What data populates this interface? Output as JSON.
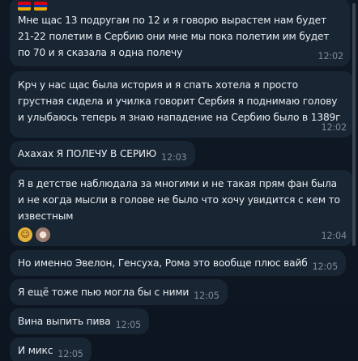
{
  "messages": [
    {
      "flags": [
        "armenia-flag",
        "armenia-flag"
      ],
      "text": "Мне щас 13 подругам по 12 и я говорю вырастем нам будет 21-22 полетим в Сербию они мне мы пока полетим им будет по 70 и я сказала я одна полечу",
      "time": "12:02"
    },
    {
      "text": "Крч у нас щас была история и я спать хотела я просто грустная сидела и училка говорит Сербия  я поднимаю голову и улыбаюсь теперь я знаю нападение на Сербию было в 1389г",
      "time": "12:02"
    },
    {
      "text": "Ахахах Я ПОЛЕЧУ В СЕРИЮ",
      "time": "12:03"
    },
    {
      "text": "Я в детстве наблюдала за многими и не такая прям фан была и не когда мысли в голове не было что хочу увидится с кем то известным",
      "time": "12:04",
      "reactions": [
        "hugging-face-reaction",
        "avatar-reaction"
      ]
    },
    {
      "text": "Но именно Эвелон, Генсуха, Рома это вообще плюс вайб",
      "time": "12:05"
    },
    {
      "text": "Я ещё тоже пью могла бы с ними",
      "time": "12:05"
    },
    {
      "text": "Вина выпить пива",
      "time": "12:05"
    },
    {
      "text": "И микс",
      "time": "12:05"
    }
  ],
  "colors": {
    "background": "#0e1621",
    "bubble": "#182533",
    "text": "#e9edf1",
    "time": "#7d8b99",
    "flag_red": "#d90012",
    "flag_blue": "#0033a0",
    "flag_orange": "#f2a800"
  }
}
